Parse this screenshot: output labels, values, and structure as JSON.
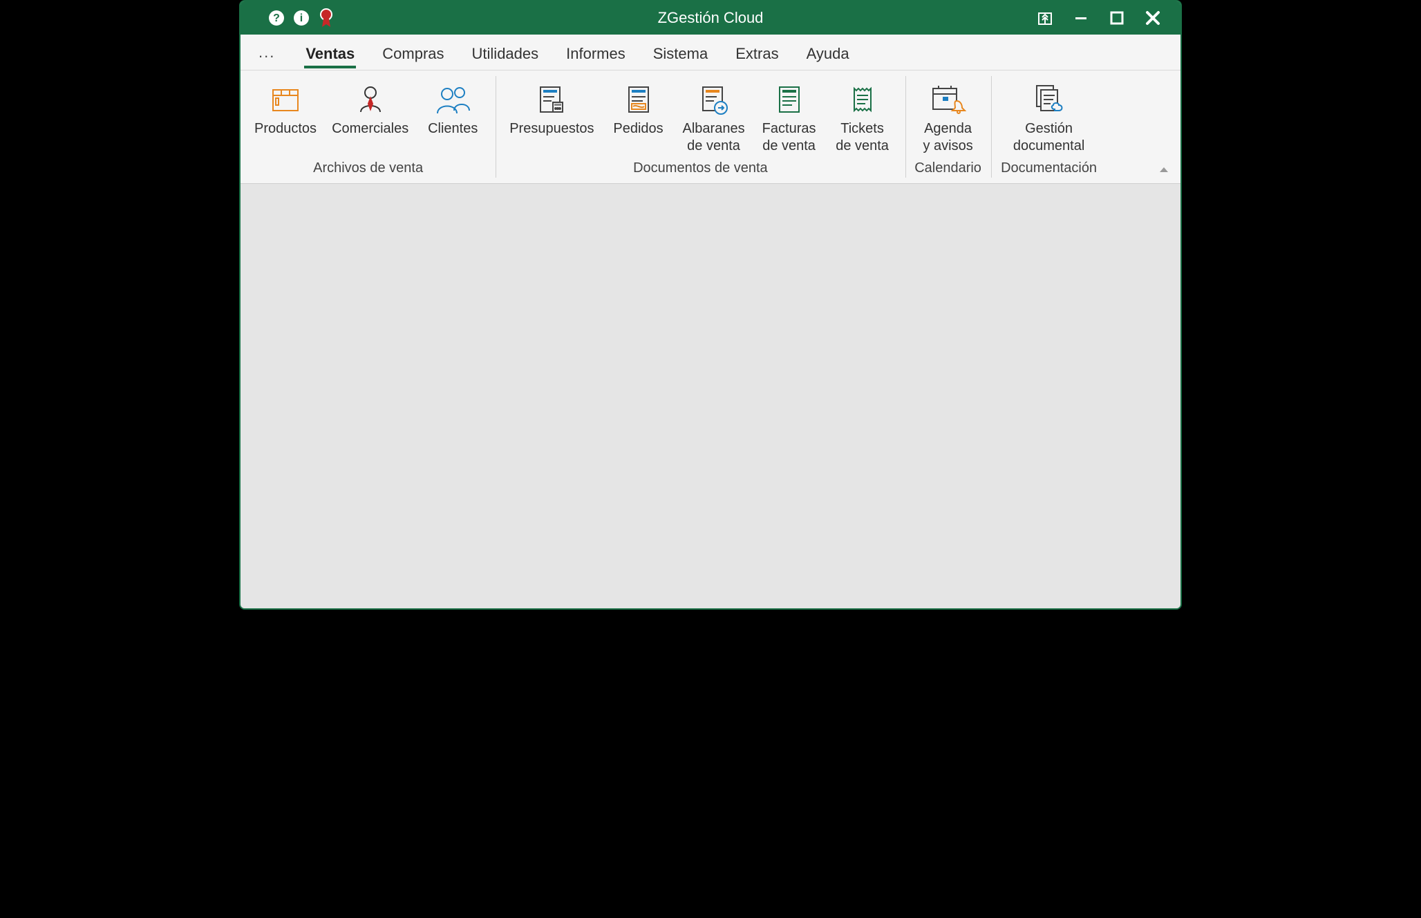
{
  "app": {
    "title": "ZGestión Cloud"
  },
  "tabs": {
    "overflow": "...",
    "items": [
      {
        "label": "Ventas",
        "active": true
      },
      {
        "label": "Compras"
      },
      {
        "label": "Utilidades"
      },
      {
        "label": "Informes"
      },
      {
        "label": "Sistema"
      },
      {
        "label": "Extras"
      },
      {
        "label": "Ayuda"
      }
    ]
  },
  "ribbon": {
    "groups": [
      {
        "label": "Archivos de venta",
        "buttons": [
          {
            "label": "Productos"
          },
          {
            "label": "Comerciales"
          },
          {
            "label": "Clientes"
          }
        ]
      },
      {
        "label": "Documentos de venta",
        "buttons": [
          {
            "label": "Presupuestos"
          },
          {
            "label": "Pedidos"
          },
          {
            "label": "Albaranes\nde venta"
          },
          {
            "label": "Facturas\nde venta"
          },
          {
            "label": "Tickets\nde venta"
          }
        ]
      },
      {
        "label": "Calendario",
        "buttons": [
          {
            "label": "Agenda\ny avisos"
          }
        ]
      },
      {
        "label": "Documentación",
        "buttons": [
          {
            "label": "Gestión\ndocumental"
          }
        ]
      }
    ]
  },
  "colors": {
    "brand": "#1a7046",
    "accentBlue": "#1d7fc2",
    "accentOrange": "#e8871e",
    "accentGreen": "#1a7046",
    "accentRed": "#c62828"
  }
}
